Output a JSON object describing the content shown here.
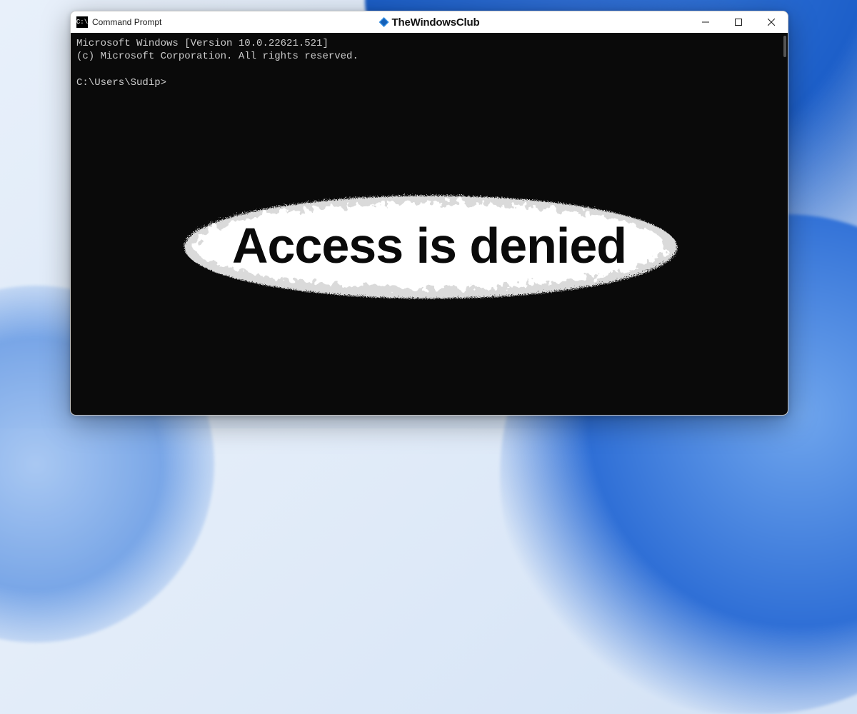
{
  "window": {
    "title": "Command Prompt",
    "brand": "TheWindowsClub"
  },
  "terminal": {
    "line1": "Microsoft Windows [Version 10.0.22621.521]",
    "line2": "(c) Microsoft Corporation. All rights reserved.",
    "prompt": "C:\\Users\\Sudip>"
  },
  "overlay": {
    "text": "Access is denied"
  },
  "colors": {
    "terminal_bg": "#0a0a0a",
    "terminal_fg": "#cccccc",
    "accent_blue": "#2f6fd6"
  }
}
